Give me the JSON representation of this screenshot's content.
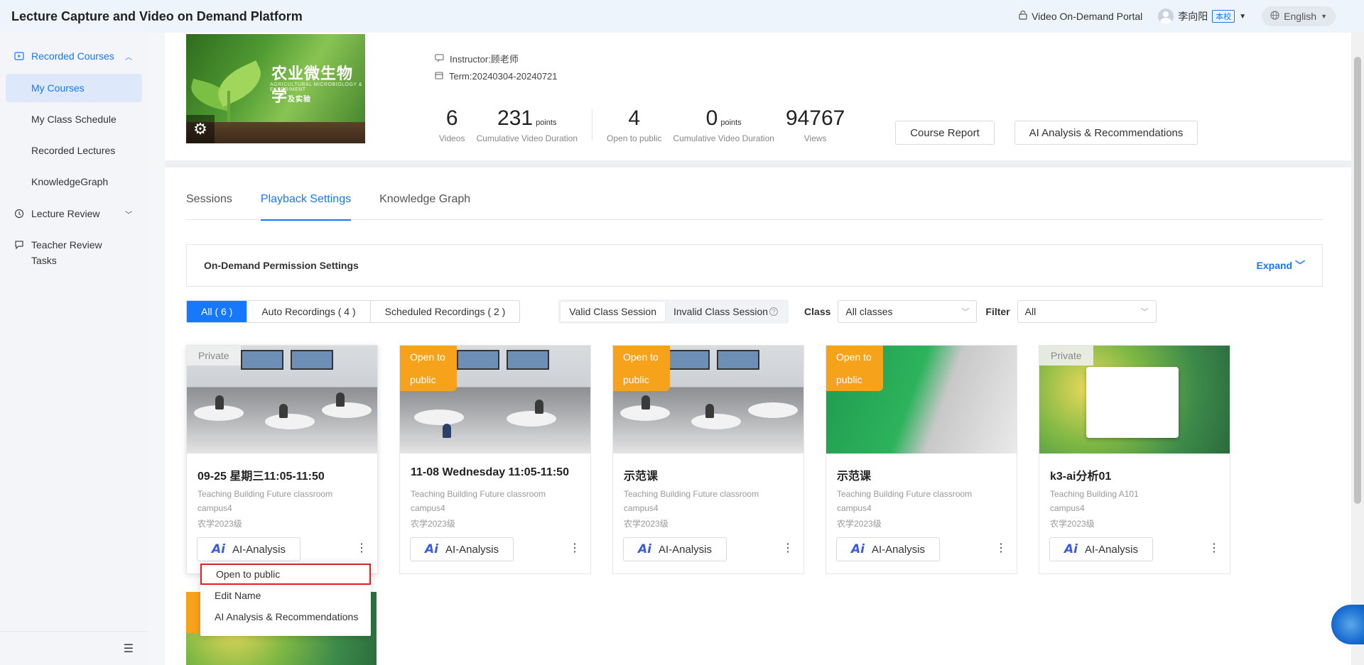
{
  "app": {
    "title": "Lecture Capture and Video on Demand Platform"
  },
  "topbar": {
    "portal_label": "Video On-Demand Portal",
    "user_name": "李向阳",
    "user_tag": "本校",
    "language": "English"
  },
  "sidebar": {
    "group_recorded": "Recorded Courses",
    "items": [
      {
        "label": "My Courses"
      },
      {
        "label": "My Class Schedule"
      },
      {
        "label": "Recorded Lectures"
      },
      {
        "label": "KnowledgeGraph"
      }
    ],
    "group_review": "Lecture Review",
    "group_teacher": "Teacher Review Tasks"
  },
  "course": {
    "cover_title": "农业微生物学",
    "cover_title_suffix": "及实验",
    "cover_subtitle": "AGRICULTURAL MICROBIOLOGY & EXPERIMENT",
    "instructor": "Instructor:顾老师",
    "term": "Term:20240304-20240721",
    "stats": [
      {
        "value": "6",
        "unit": "",
        "label": "Videos"
      },
      {
        "value": "231",
        "unit": "points",
        "label": "Cumulative Video Duration"
      },
      {
        "value": "4",
        "unit": "",
        "label": "Open to public"
      },
      {
        "value": "0",
        "unit": "points",
        "label": "Cumulative Video Duration"
      },
      {
        "value": "94767",
        "unit": "",
        "label": "Views"
      }
    ],
    "report_button": "Course Report",
    "ai_button": "AI Analysis & Recommendations"
  },
  "tabs": [
    {
      "label": "Sessions"
    },
    {
      "label": "Playback Settings"
    },
    {
      "label": "Knowledge Graph"
    }
  ],
  "permission": {
    "title": "On-Demand Permission Settings",
    "expand": "Expand"
  },
  "filters": {
    "segments": [
      {
        "label": "All ( 6 )"
      },
      {
        "label": "Auto Recordings ( 4 )"
      },
      {
        "label": "Scheduled Recordings ( 2 )"
      }
    ],
    "valid": "Valid Class Session",
    "invalid": "Invalid Class Session",
    "class_label": "Class",
    "class_value": "All classes",
    "filter_label": "Filter",
    "filter_value": "All"
  },
  "cards": [
    {
      "badge": "Private",
      "title": "09-25 星期三11:05-11:50",
      "location": "Teaching Building Future classroom",
      "campus": "campus4",
      "class": "农学2023级",
      "ai": "AI-Analysis"
    },
    {
      "badge": "Open to public",
      "title": "11-08 Wednesday 11:05-11:50",
      "location": "Teaching Building Future classroom",
      "campus": "campus4",
      "class": "农学2023级",
      "ai": "AI-Analysis"
    },
    {
      "badge": "Open to public",
      "title": "示范课",
      "location": "Teaching Building Future classroom",
      "campus": "campus4",
      "class": "农学2023级",
      "ai": "AI-Analysis"
    },
    {
      "badge": "Open to public",
      "title": "示范课",
      "location": "Teaching Building Future classroom",
      "campus": "campus4",
      "class": "农学2023级",
      "ai": "AI-Analysis"
    },
    {
      "badge": "Private",
      "title": "k3-ai分析01",
      "location": "Teaching Building A101",
      "campus": "campus4",
      "class": "农学2023级",
      "ai": "AI-Analysis"
    }
  ],
  "menu": {
    "items": [
      {
        "label": "Open to public"
      },
      {
        "label": "Edit Name"
      },
      {
        "label": "AI Analysis & Recommendations"
      }
    ]
  },
  "colors": {
    "accent": "#1677ff",
    "public_badge": "#f7a21b",
    "highlight": "#e02020"
  }
}
